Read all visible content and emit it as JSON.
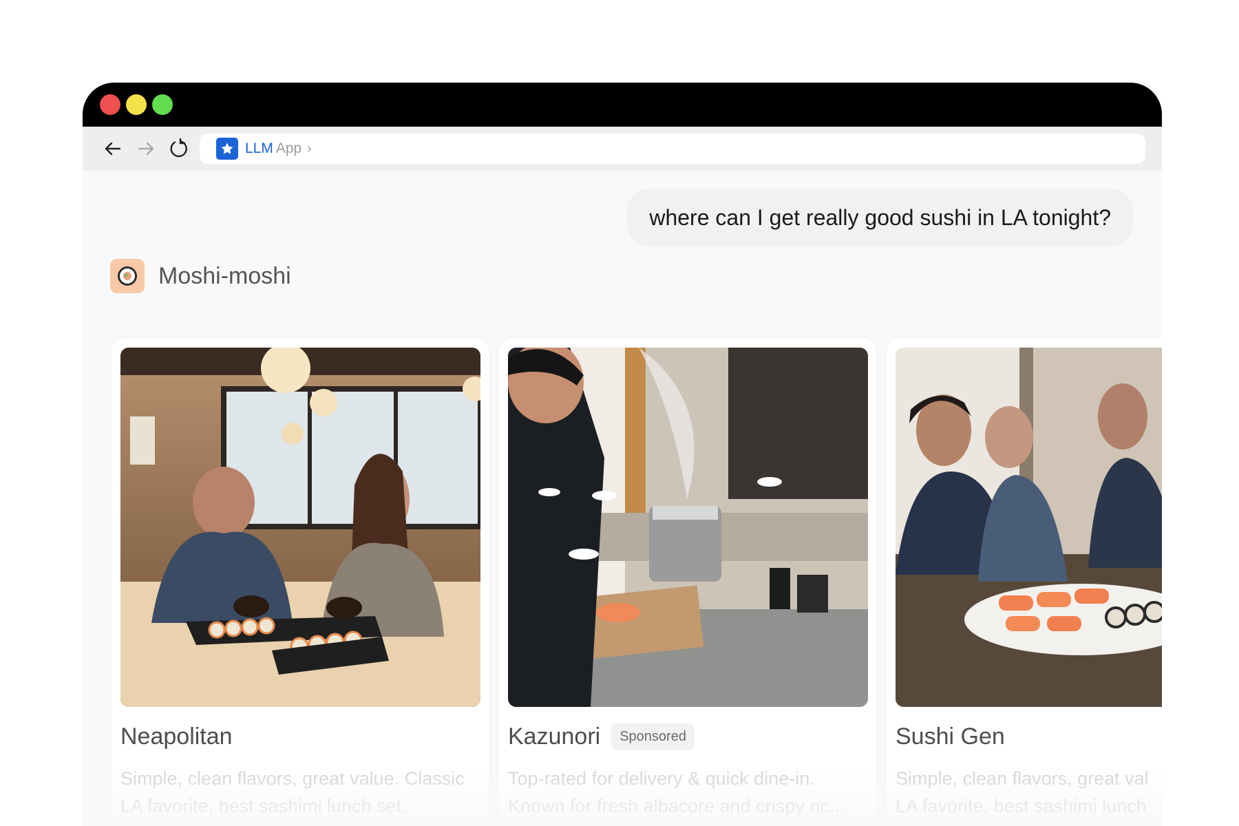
{
  "browser": {
    "window_controls": [
      "close",
      "minimize",
      "zoom"
    ],
    "address_bar": {
      "brand": "LLM",
      "app": "App",
      "chevron": "›"
    }
  },
  "chat": {
    "user_message": "where can I get really good sushi in LA tonight?",
    "assistant_name": "Moshi-moshi"
  },
  "cards": [
    {
      "title": "Neapolitan",
      "badge": "",
      "desc_line1": "Simple, clean flavors, great value. Classic",
      "desc_line2": "LA favorite, best sashimi lunch set."
    },
    {
      "title": "Kazunori",
      "badge": "Sponsored",
      "desc_line1": "Top-rated for delivery & quick dine-in.",
      "desc_line2": "Known for fresh albacore and crispy ric..."
    },
    {
      "title": "Sushi Gen",
      "badge": "",
      "desc_line1": "Simple, clean flavors, great val",
      "desc_line2": "LA favorite, best sashimi lunch"
    }
  ],
  "colors": {
    "brand_blue": "#1a64d6",
    "close_red": "#ef4f4f",
    "min_yellow": "#f4e24b",
    "zoom_green": "#63dc4f",
    "avatar_bg": "#f8c9a8"
  }
}
